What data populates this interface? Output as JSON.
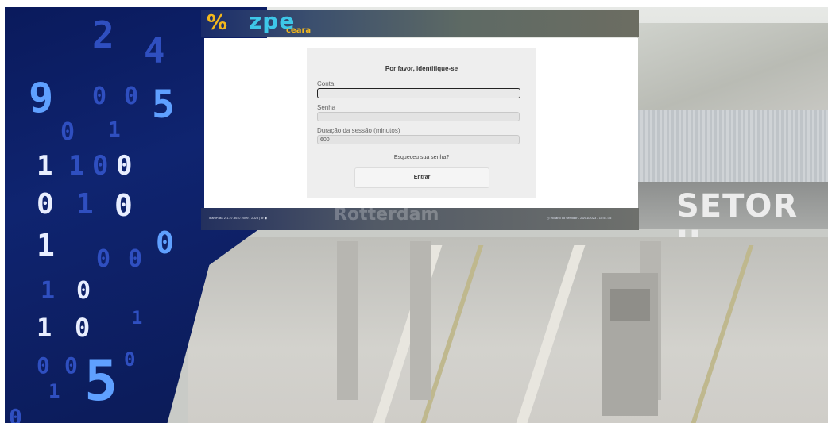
{
  "header": {
    "logo_text": "zpe",
    "logo_sub": "ceara"
  },
  "background": {
    "sign_text": "SETOR II",
    "watermark": "Rotterdam",
    "digits": [
      "2",
      "4",
      "9",
      "0",
      "0",
      "5",
      "0",
      "1",
      "1",
      "1",
      "0",
      "0",
      "0",
      "1",
      "0",
      "1",
      "0",
      "0",
      "0",
      "1",
      "0",
      "1",
      "0",
      "1",
      "0",
      "0",
      "1",
      "0",
      "0",
      "5"
    ]
  },
  "login": {
    "title": "Por favor, identifique-se",
    "account_label": "Conta",
    "account_value": "",
    "password_label": "Senha",
    "password_value": "",
    "session_label": "Duração da sessão (minutos)",
    "session_value": "600",
    "forgot_link": "Esqueceu sua senha?",
    "submit_label": "Entrar"
  },
  "footer": {
    "left_text": "TeamPass 2.1.27.36 © 2009 - 2023 | ⊕ ◉",
    "right_text": "◷ Horário do servidor - 26/01/2023 - 15:51:15"
  },
  "colors": {
    "panel_dark_blue": "#0f2470",
    "logo_yellow": "#f3b81c",
    "logo_cyan": "#3ec7e8",
    "login_bg": "#eeeeee"
  }
}
